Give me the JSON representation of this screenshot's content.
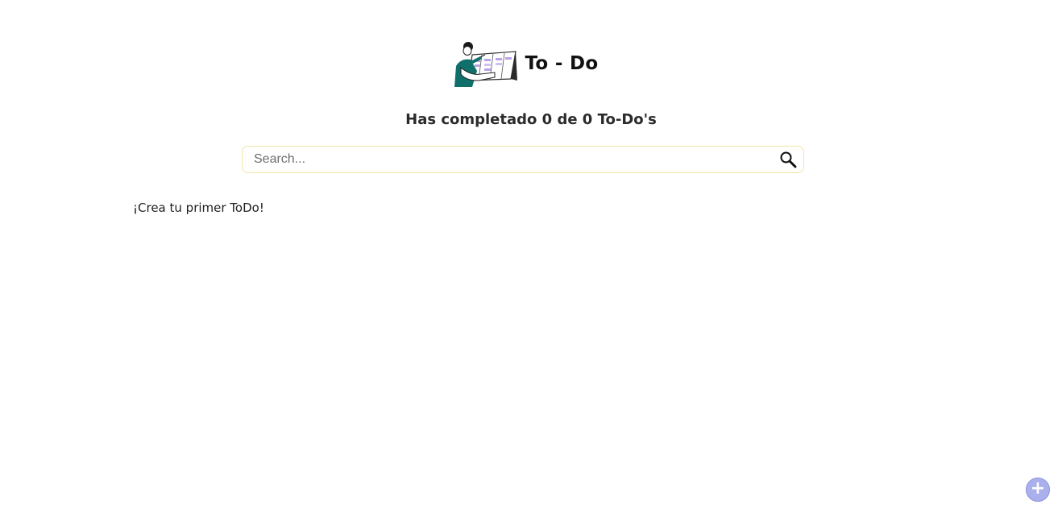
{
  "header": {
    "title": "To - Do",
    "logo_icon": "person-with-kanban-board-illustration"
  },
  "counter": {
    "text": "Has completado 0 de 0 To-Do's",
    "completed": 0,
    "total": 0
  },
  "search": {
    "placeholder": "Search...",
    "value": "",
    "icon": "search-icon"
  },
  "main": {
    "empty_message": "¡Crea tu primer ToDo!"
  },
  "fab": {
    "label": "+",
    "icon": "plus-icon",
    "color": "#aab0ec"
  },
  "colors": {
    "accent_teal": "#0f6f6b",
    "search_border": "#f3e3a6",
    "fab": "#aab0ec"
  }
}
